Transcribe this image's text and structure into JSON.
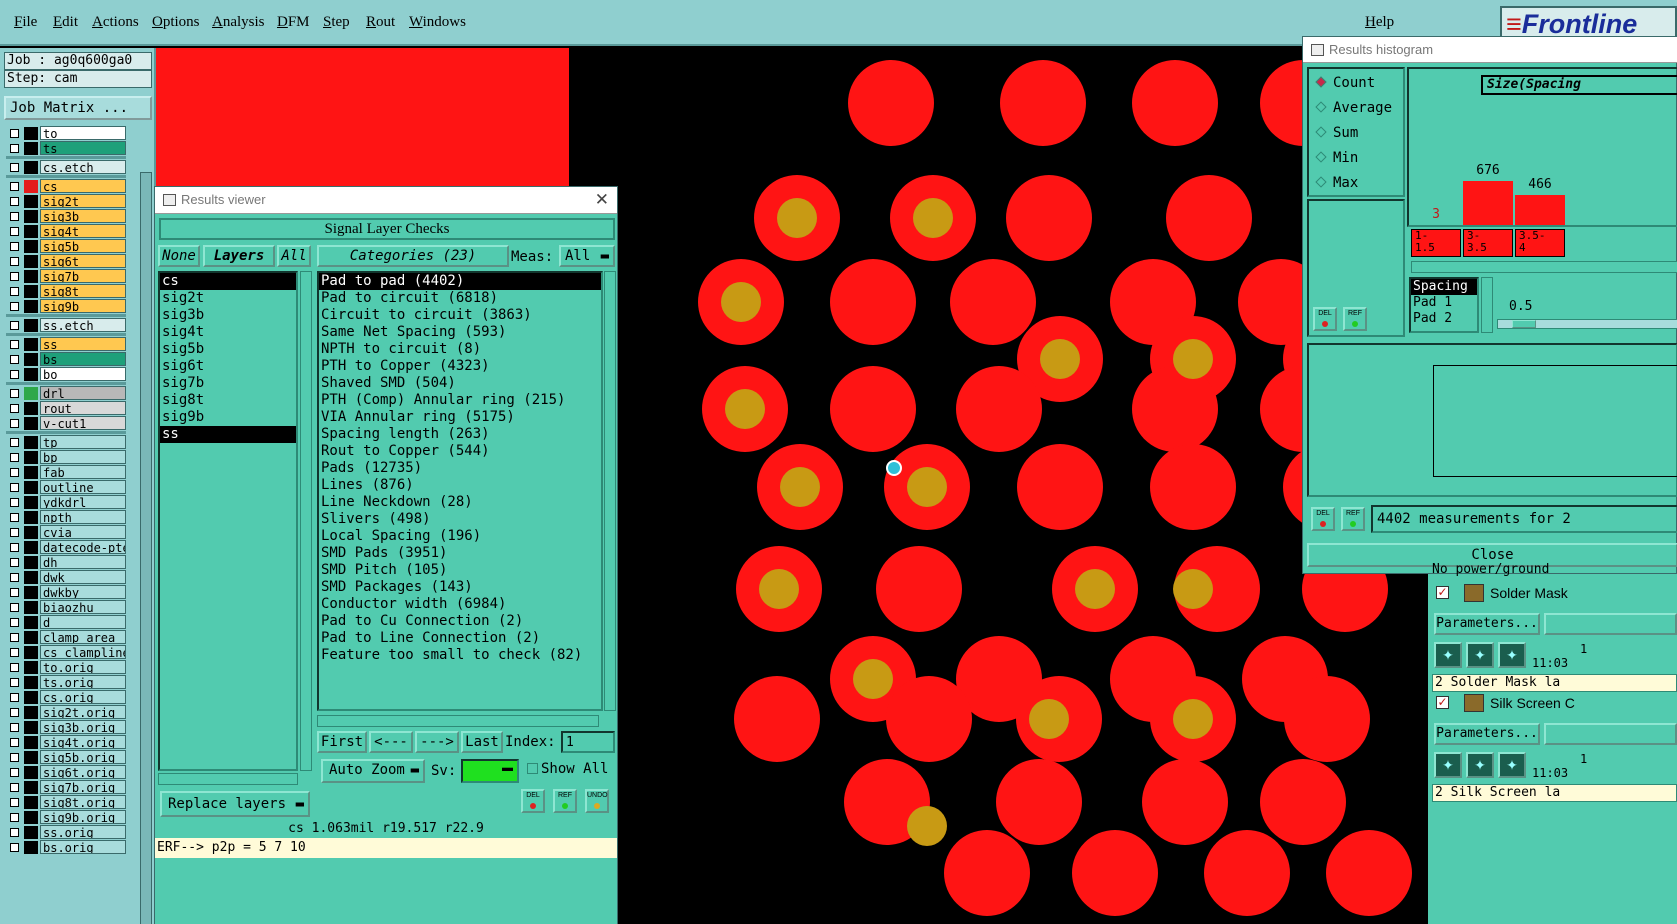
{
  "menu": [
    "File",
    "Edit",
    "Actions",
    "Options",
    "Analysis",
    "DFM",
    "Step",
    "Rout",
    "Windows"
  ],
  "help_label": "Help",
  "logo_text": "Frontline",
  "job": {
    "job_line": "Job : ag0q600ga0",
    "step_line": "Step: cam",
    "job_matrix_label": "Job Matrix ..."
  },
  "layers": [
    {
      "name": "to",
      "bg": "#ffffff",
      "sw": "#000000"
    },
    {
      "name": "ts",
      "bg": "#1ea07a",
      "sw": "#000000"
    },
    {
      "name": "cs.etch",
      "bg": "#d8ecec",
      "sw": "#000000"
    },
    {
      "name": "cs",
      "bg": "#ffc850",
      "sw": "#e41c1c",
      "mark": "▪"
    },
    {
      "name": "sig2t",
      "bg": "#ffc850",
      "sw": "#000000"
    },
    {
      "name": "sig3b",
      "bg": "#ffc850",
      "sw": "#000000"
    },
    {
      "name": "sig4t",
      "bg": "#ffc850",
      "sw": "#000000"
    },
    {
      "name": "sig5b",
      "bg": "#ffc850",
      "sw": "#000000"
    },
    {
      "name": "sig6t",
      "bg": "#ffc850",
      "sw": "#000000"
    },
    {
      "name": "sig7b",
      "bg": "#ffc850",
      "sw": "#000000"
    },
    {
      "name": "sig8t",
      "bg": "#ffc850",
      "sw": "#000000"
    },
    {
      "name": "sig9b",
      "bg": "#ffc850",
      "sw": "#000000"
    },
    {
      "name": "ss.etch",
      "bg": "#d8ecec",
      "sw": "#000000"
    },
    {
      "name": "ss",
      "bg": "#ffc850",
      "sw": "#000000"
    },
    {
      "name": "bs",
      "bg": "#1ea07a",
      "sw": "#000000"
    },
    {
      "name": "bo",
      "bg": "#ffffff",
      "sw": "#000000"
    },
    {
      "name": "drl",
      "bg": "#b8b8b8",
      "sw": "#2ea84a"
    },
    {
      "name": "rout",
      "bg": "#d8d8d8",
      "sw": "#000000"
    },
    {
      "name": "v-cut1",
      "bg": "#d8d8d8",
      "sw": "#000000"
    },
    {
      "name": "tp",
      "bg": "#a8dcdc",
      "sw": "#000000"
    },
    {
      "name": "bp",
      "bg": "#a8dcdc",
      "sw": "#000000"
    },
    {
      "name": "fab",
      "bg": "#a8dcdc",
      "sw": "#000000"
    },
    {
      "name": "outline",
      "bg": "#a8dcdc",
      "sw": "#000000"
    },
    {
      "name": "ydkdrl",
      "bg": "#a8dcdc",
      "sw": "#000000"
    },
    {
      "name": "npth",
      "bg": "#a8dcdc",
      "sw": "#000000"
    },
    {
      "name": "cvia",
      "bg": "#a8dcdc",
      "sw": "#000000"
    },
    {
      "name": "datecode-pte",
      "bg": "#a8dcdc",
      "sw": "#000000"
    },
    {
      "name": "dh",
      "bg": "#a8dcdc",
      "sw": "#000000"
    },
    {
      "name": "dwk",
      "bg": "#a8dcdc",
      "sw": "#000000"
    },
    {
      "name": "dwkby",
      "bg": "#a8dcdc",
      "sw": "#000000"
    },
    {
      "name": "biaozhu",
      "bg": "#a8dcdc",
      "sw": "#000000"
    },
    {
      "name": "d",
      "bg": "#a8dcdc",
      "sw": "#000000"
    },
    {
      "name": "clamp_area",
      "bg": "#a8dcdc",
      "sw": "#000000"
    },
    {
      "name": "cs_clampline",
      "bg": "#a8dcdc",
      "sw": "#000000"
    },
    {
      "name": "to.orig",
      "bg": "#a8dcdc",
      "sw": "#000000"
    },
    {
      "name": "ts.orig",
      "bg": "#a8dcdc",
      "sw": "#000000"
    },
    {
      "name": "cs.orig",
      "bg": "#a8dcdc",
      "sw": "#000000"
    },
    {
      "name": "sig2t.orig",
      "bg": "#a8dcdc",
      "sw": "#000000"
    },
    {
      "name": "sig3b.orig",
      "bg": "#a8dcdc",
      "sw": "#000000"
    },
    {
      "name": "sig4t.orig",
      "bg": "#a8dcdc",
      "sw": "#000000"
    },
    {
      "name": "sig5b.orig",
      "bg": "#a8dcdc",
      "sw": "#000000"
    },
    {
      "name": "sig6t.orig",
      "bg": "#a8dcdc",
      "sw": "#000000"
    },
    {
      "name": "sig7b.orig",
      "bg": "#a8dcdc",
      "sw": "#000000"
    },
    {
      "name": "sig8t.orig",
      "bg": "#a8dcdc",
      "sw": "#000000"
    },
    {
      "name": "sig9b.orig",
      "bg": "#a8dcdc",
      "sw": "#000000"
    },
    {
      "name": "ss.orig",
      "bg": "#a8dcdc",
      "sw": "#000000"
    },
    {
      "name": "bs.orig",
      "bg": "#a8dcdc",
      "sw": "#000000"
    }
  ],
  "results_viewer": {
    "title": "Results viewer",
    "header": "Signal Layer Checks",
    "none_label": "None",
    "layers_label": "Layers",
    "all_label": "All",
    "categories_label": "Categories (23)",
    "meas_label": "Meas:",
    "meas_value": "All",
    "layers": [
      "cs",
      "sig2t",
      "sig3b",
      "sig4t",
      "sig5b",
      "sig6t",
      "sig7b",
      "sig8t",
      "sig9b",
      "ss"
    ],
    "layers_selected": [
      "cs",
      "ss"
    ],
    "categories": [
      "Pad to pad (4402)",
      "Pad to circuit (6818)",
      "Circuit to circuit (3863)",
      "Same Net Spacing (593)",
      "NPTH to circuit (8)",
      "PTH to Copper (4323)",
      "Shaved SMD (504)",
      "PTH (Comp) Annular ring (215)",
      "VIA Annular ring (5175)",
      "Spacing length (263)",
      "Rout to Copper (544)",
      "Pads (12735)",
      "Lines (876)",
      "Line Neckdown (28)",
      "Slivers (498)",
      "Local Spacing (196)",
      "SMD Pads (3951)",
      "SMD Pitch (105)",
      "SMD Packages (143)",
      "Conductor width (6984)",
      "Pad to Cu Connection (2)",
      "Pad to Line Connection (2)",
      "Feature too small to check (82)"
    ],
    "category_selected": "Pad to pad (4402)",
    "first_label": "First",
    "prev_label": "<---",
    "next_label": "--->",
    "last_label": "Last",
    "index_label": "Index:",
    "index_value": "1",
    "auto_zoom_label": "Auto Zoom",
    "sv_label": "Sv:",
    "show_all_label": "Show All",
    "replace_layers_label": "Replace layers",
    "del_label": "DEL",
    "ref_label": "REF",
    "undo_label": "UNDO",
    "status_line": "cs 1.063mil  r19.517  r22.9",
    "erf_line": "ERF--> p2p = 5 7 10"
  },
  "histogram": {
    "title": "Results histogram",
    "modes": [
      "Count",
      "Average",
      "Sum",
      "Min",
      "Max"
    ],
    "mode_selected": "Count",
    "header_label": "Size(Spacing",
    "bins": [
      {
        "label": "1-\n1.5",
        "count": 3
      },
      {
        "label": "3-\n3.5",
        "count": 676
      },
      {
        "label": "3.5-\n4",
        "count": 466
      }
    ],
    "fields": [
      "Spacing",
      "Pad 1",
      "Pad 2"
    ],
    "field_selected": "Spacing",
    "step_value": "0.5",
    "measurements_text": "4402 measurements for 2",
    "close_label": "Close",
    "del_label": "DEL",
    "ref_label": "REF"
  },
  "dfm_panel": {
    "cut_text": "No power/ground",
    "sections": [
      {
        "name": "Solder Mask",
        "params_label": "Parameters...",
        "time": "11:03",
        "counter": "1",
        "status": "2 Solder Mask la"
      },
      {
        "name": "Silk Screen C",
        "params_label": "Parameters...",
        "time": "11:03",
        "counter": "1",
        "status": "2 Silk Screen la"
      }
    ]
  }
}
